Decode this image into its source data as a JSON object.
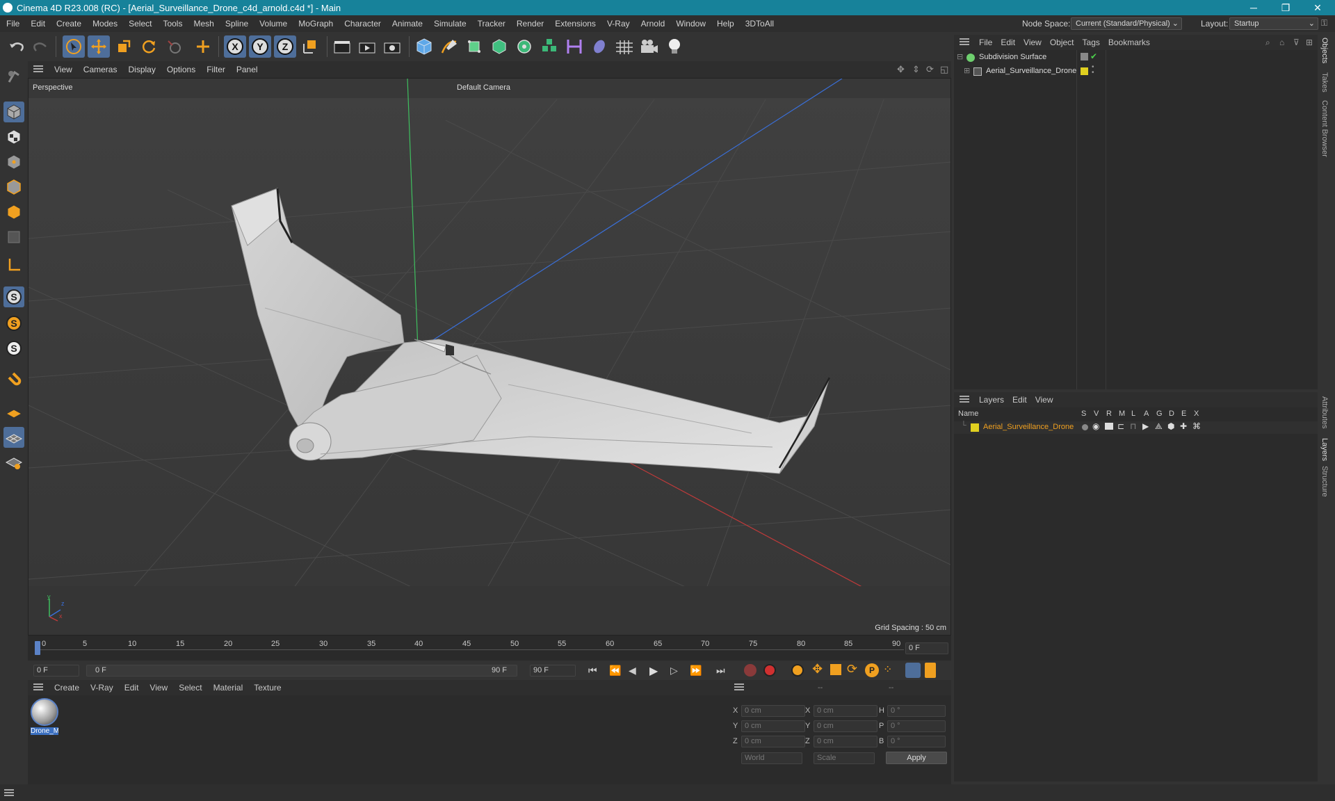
{
  "titlebar": {
    "title": "Cinema 4D R23.008 (RC) - [Aerial_Surveillance_Drone_c4d_arnold.c4d *] - Main",
    "minimize": "─",
    "restore": "❐",
    "close": "✕"
  },
  "menubar": {
    "items": [
      "File",
      "Edit",
      "Create",
      "Modes",
      "Select",
      "Tools",
      "Mesh",
      "Spline",
      "Volume",
      "MoGraph",
      "Character",
      "Animate",
      "Simulate",
      "Tracker",
      "Render",
      "Extensions",
      "V-Ray",
      "Arnold",
      "Window",
      "Help",
      "3DToAll"
    ],
    "node_space_label": "Node Space:",
    "node_space_value": "Current (Standard/Physical)",
    "layout_label": "Layout:",
    "layout_value": "Startup"
  },
  "viewport": {
    "menu": [
      "View",
      "Cameras",
      "Display",
      "Options",
      "Filter",
      "Panel"
    ],
    "view_name": "Perspective",
    "camera": "Default Camera",
    "grid_spacing": "Grid Spacing : 50 cm",
    "axis_y": "y",
    "axis_z": "z",
    "axis_x": "x"
  },
  "timeline": {
    "ticks": [
      "0",
      "5",
      "10",
      "15",
      "20",
      "25",
      "30",
      "35",
      "40",
      "45",
      "50",
      "55",
      "60",
      "65",
      "70",
      "75",
      "80",
      "85",
      "90"
    ],
    "end_field": "0 F"
  },
  "transport": {
    "current_frame": "0 F",
    "range_start": "0 F",
    "range_end": "90 F",
    "max_frame": "90 F"
  },
  "material_manager": {
    "menu": [
      "Create",
      "V-Ray",
      "Edit",
      "View",
      "Select",
      "Material",
      "Texture"
    ],
    "material_name": "Drone_M"
  },
  "coordinates": {
    "header": [
      "--",
      "--",
      "--"
    ],
    "rows": [
      {
        "a": "X",
        "av": "0 cm",
        "b": "X",
        "bv": "0 cm",
        "c": "H",
        "cv": "0 °"
      },
      {
        "a": "Y",
        "av": "0 cm",
        "b": "Y",
        "bv": "0 cm",
        "c": "P",
        "cv": "0 °"
      },
      {
        "a": "Z",
        "av": "0 cm",
        "b": "Z",
        "bv": "0 cm",
        "c": "B",
        "cv": "0 °"
      }
    ],
    "mode": "World",
    "scale": "Scale",
    "apply": "Apply"
  },
  "object_manager": {
    "menu": [
      "File",
      "Edit",
      "View",
      "Object",
      "Tags",
      "Bookmarks"
    ],
    "objects": [
      {
        "name": "Subdivision Surface",
        "color": "#6ecf6e"
      },
      {
        "name": "Aerial_Surveillance_Drone",
        "color": "#e0d020"
      }
    ]
  },
  "layer_manager": {
    "menu": [
      "Layers",
      "Edit",
      "View"
    ],
    "header_name": "Name",
    "columns": [
      "S",
      "V",
      "R",
      "M",
      "L",
      "A",
      "G",
      "D",
      "E",
      "X"
    ],
    "layer_name": "Aerial_Surveillance_Drone",
    "layer_color": "#e0d020"
  },
  "right_tabs": [
    "Objects",
    "Takes",
    "Content Browser",
    "Attributes",
    "Layers",
    "Structure"
  ],
  "colors": {
    "titlebar": "#17829a",
    "accent_orange": "#f0a020",
    "selected_tool": "#4e6e9a",
    "layer_text": "#f0a020"
  }
}
